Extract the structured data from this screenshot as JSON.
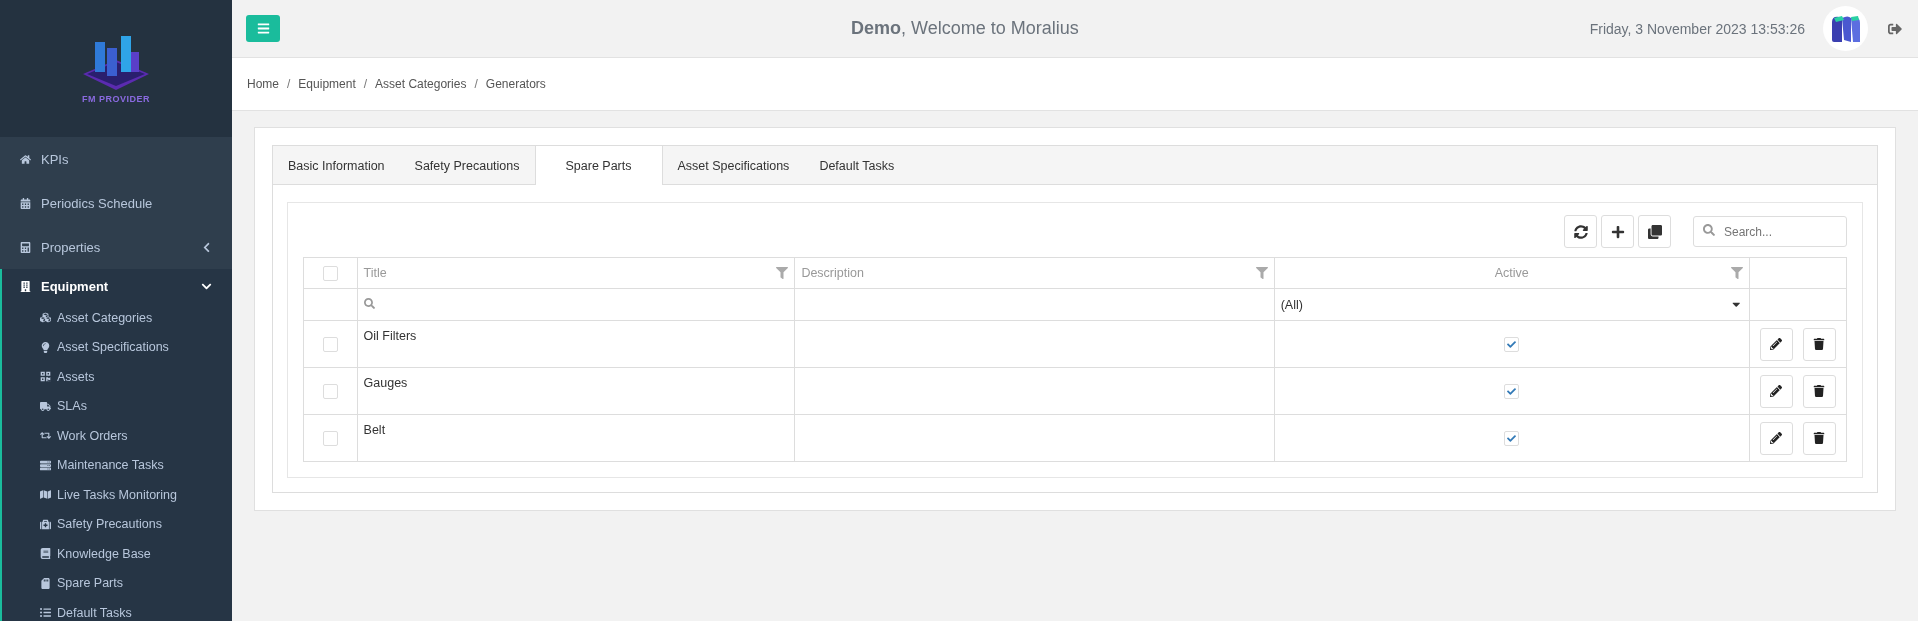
{
  "sidebar": {
    "logo_text": "FM PROVIDER",
    "items": [
      {
        "label": "KPIs",
        "selected": false
      },
      {
        "label": "Periodics Schedule",
        "selected": false
      },
      {
        "label": "Properties",
        "selected": false,
        "expanded": false
      },
      {
        "label": "Equipment",
        "selected": true,
        "expanded": true,
        "children": [
          {
            "label": "Asset Categories",
            "selected": false
          },
          {
            "label": "Asset Specifications",
            "selected": false
          },
          {
            "label": "Assets",
            "selected": false
          },
          {
            "label": "SLAs",
            "selected": false
          },
          {
            "label": "Work Orders",
            "selected": false
          },
          {
            "label": "Maintenance Tasks",
            "selected": false
          },
          {
            "label": "Live Tasks Monitoring",
            "selected": false
          },
          {
            "label": "Safety Precautions",
            "selected": false
          },
          {
            "label": "Knowledge Base",
            "selected": false
          },
          {
            "label": "Spare Parts",
            "selected": false
          },
          {
            "label": "Default Tasks",
            "selected": false
          }
        ]
      }
    ]
  },
  "header": {
    "user": "Demo",
    "welcome": ", Welcome to Moralius",
    "datetime": "Friday, 3 November 2023 13:53:26"
  },
  "breadcrumb": {
    "separator": "/",
    "items": [
      "Home",
      "Equipment",
      "Asset Categories",
      "Generators"
    ]
  },
  "tabs": [
    {
      "label": "Basic Information",
      "selected": false
    },
    {
      "label": "Safety Precautions",
      "selected": false
    },
    {
      "label": "Spare Parts",
      "selected": true
    },
    {
      "label": "Asset Specifications",
      "selected": false
    },
    {
      "label": "Default Tasks",
      "selected": false
    }
  ],
  "search": {
    "placeholder": "Search..."
  },
  "table": {
    "select_all_checked": false,
    "columns": [
      "Title",
      "Description",
      "Active"
    ],
    "active_filter": "(All)",
    "rows": [
      {
        "checked": false,
        "title": "Oil Filters",
        "active": true
      },
      {
        "checked": false,
        "title": "Gauges",
        "active": true
      },
      {
        "checked": false,
        "title": "Belt",
        "active": true
      }
    ]
  }
}
